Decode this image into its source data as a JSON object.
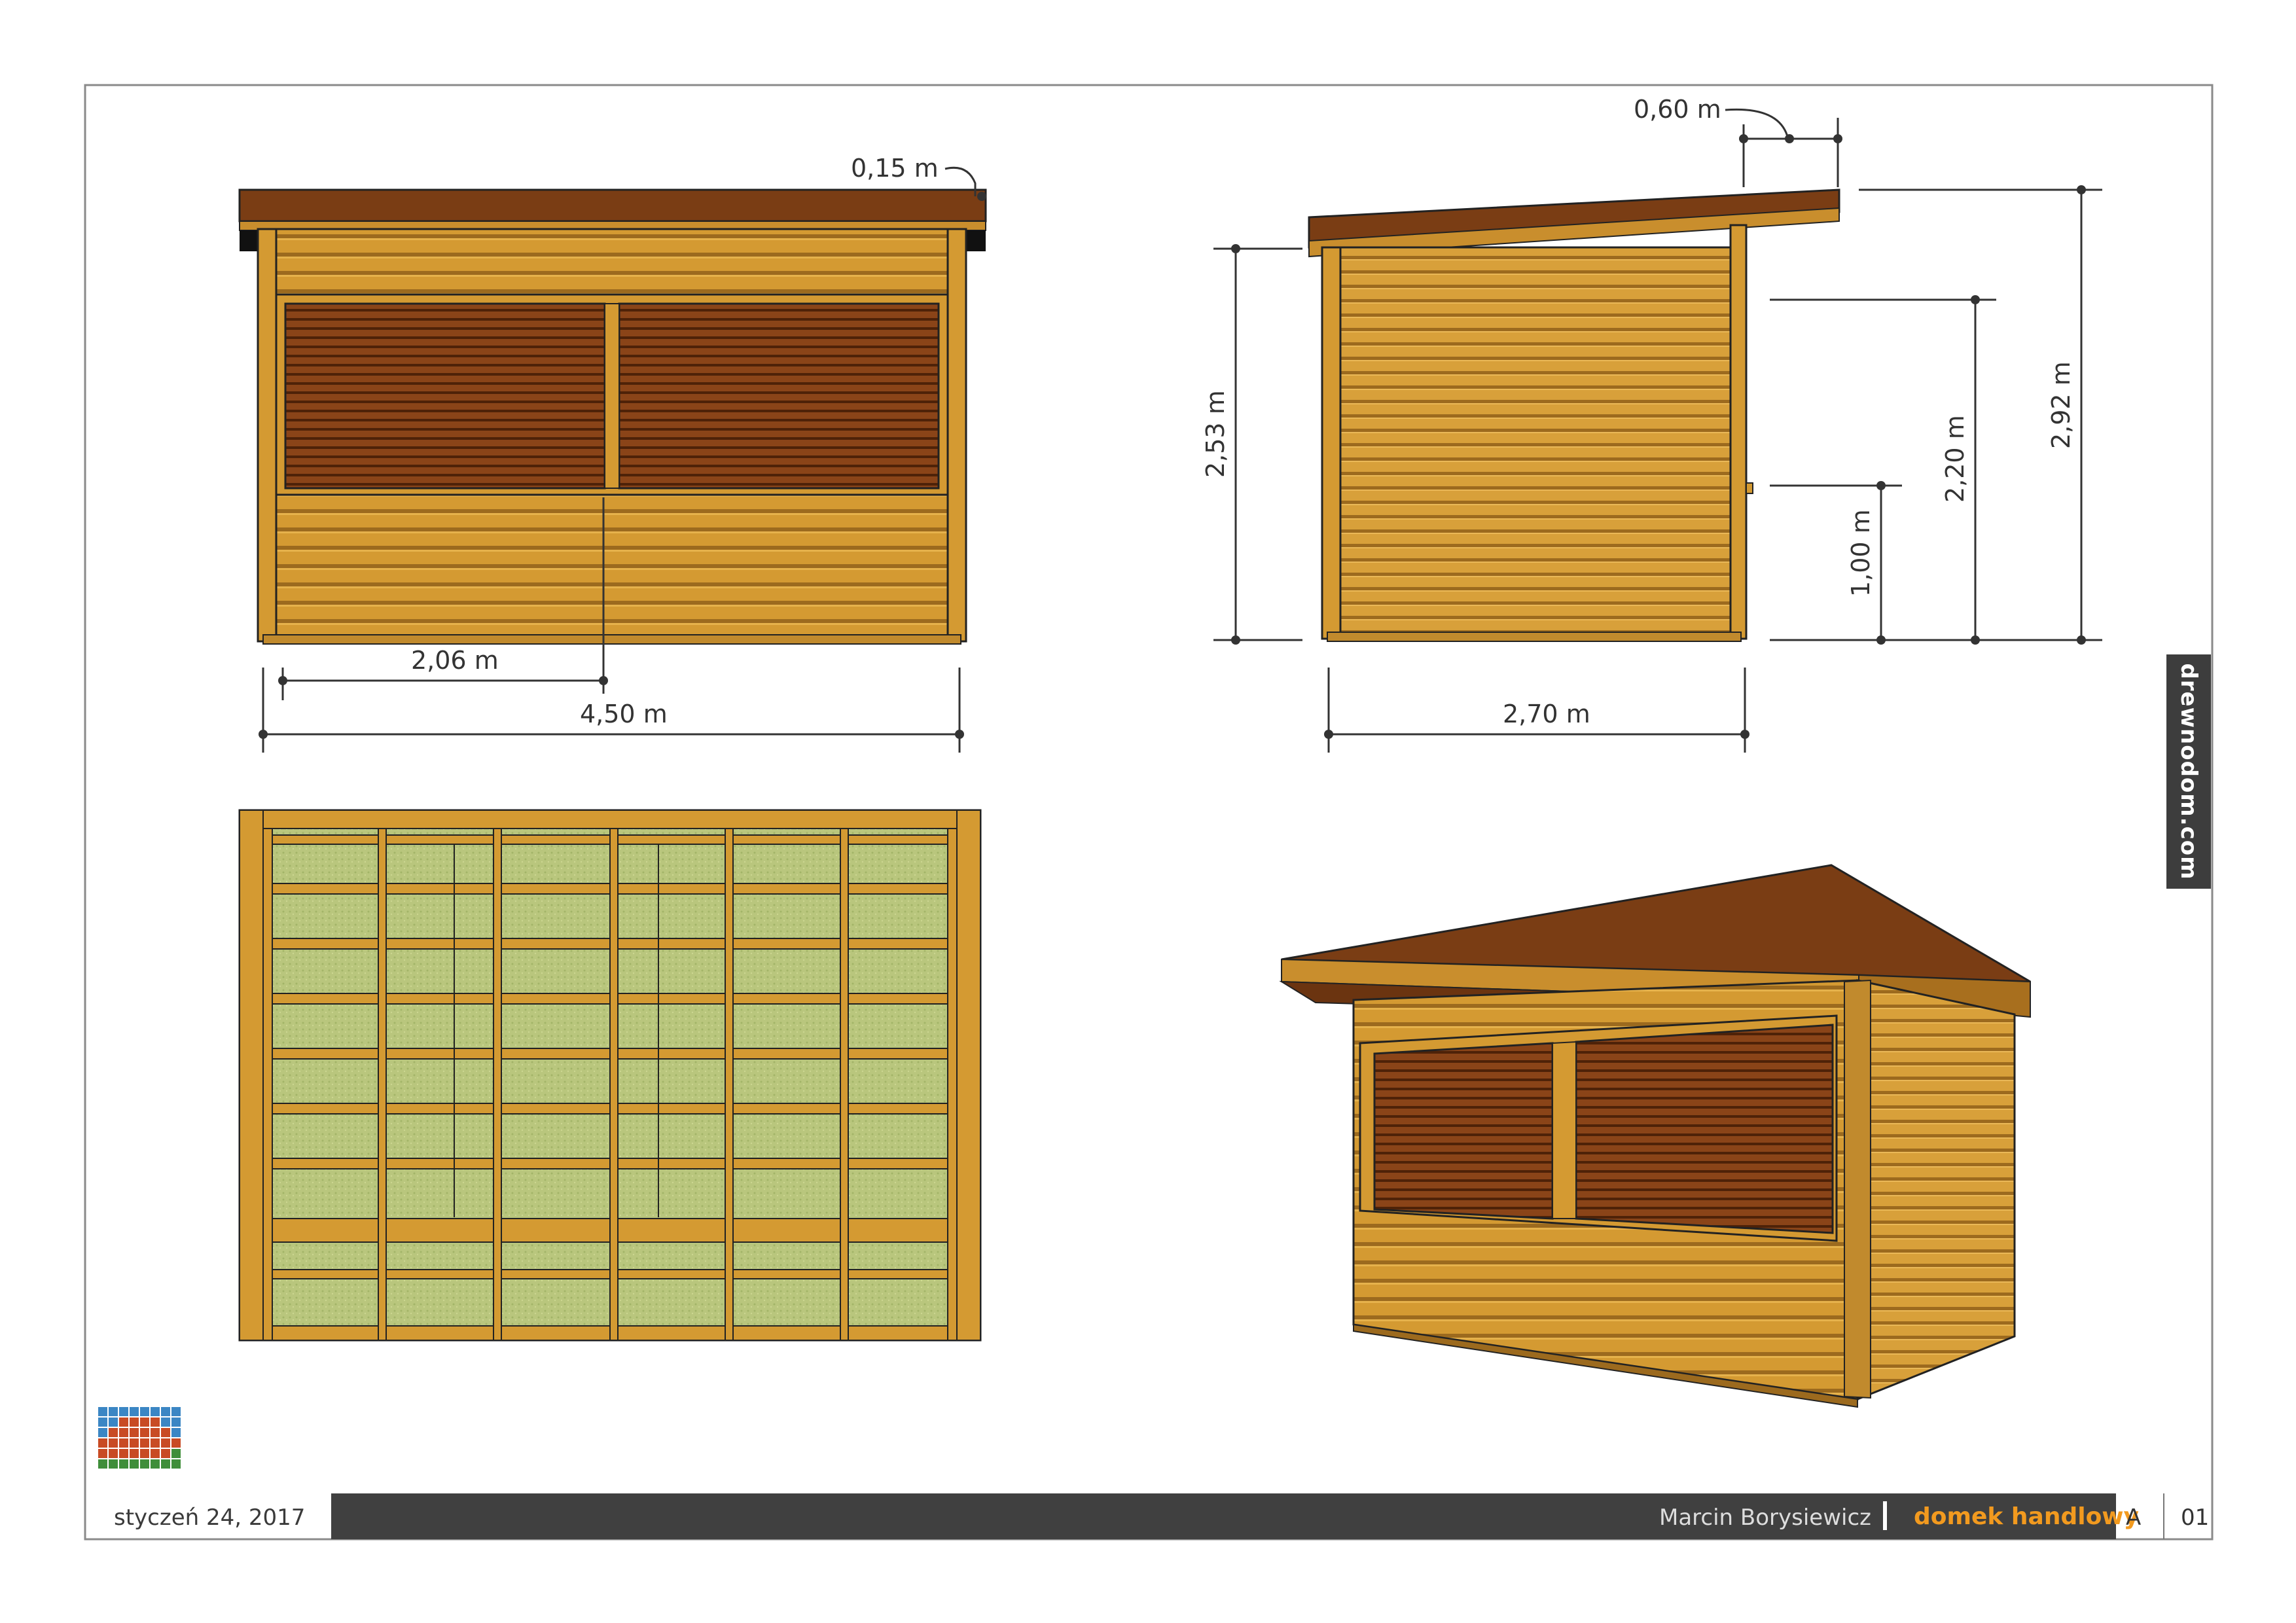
{
  "brand": {
    "site": "drewnodom.com"
  },
  "footer": {
    "date": "styczeń 24, 2017",
    "author": "Marcin Borysiewicz",
    "title": "domek handlowy",
    "revision": "A",
    "sheet": "01"
  },
  "dimensions": {
    "front": {
      "roof_overhang": "0,15 m",
      "window_half": "2,06 m",
      "total_width": "4,50 m"
    },
    "side": {
      "roof_overhang": "0,60 m",
      "wall_height": "2,53 m",
      "window_bottom": "1,00 m",
      "window_top": "2,20 m",
      "total_height": "2,92 m",
      "depth": "2,70 m"
    }
  },
  "colors": {
    "wood": "#d49a32",
    "wood_dark": "#a86f1e",
    "roof": "#7a3d14",
    "shutter": "#8a4418",
    "panel_green": "#b7c47a",
    "footer_bar": "#404040",
    "accent": "#f29a1f"
  }
}
